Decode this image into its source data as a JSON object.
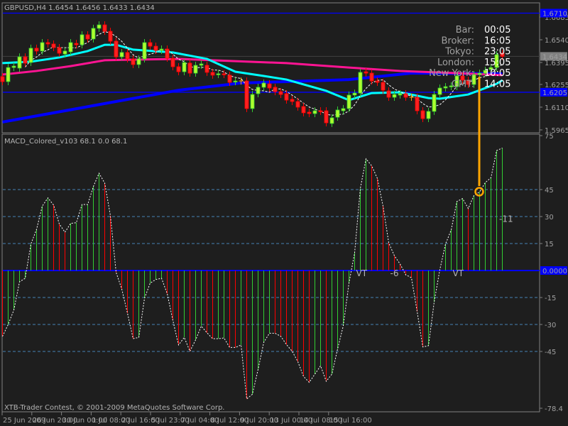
{
  "price_panel": {
    "title": "GBPUSD,H4  1.6454 1.6456 1.6433 1.6434",
    "axis_labels": [
      "1.6685",
      "1.6540",
      "1.6395",
      "1.6255",
      "1.6110",
      "1.5965"
    ],
    "axis_values": [
      1.6685,
      1.654,
      1.6395,
      1.6255,
      1.611,
      1.5965
    ],
    "hlines": [
      {
        "label": "1.6710",
        "value": 1.671,
        "color": "#0000ff"
      },
      {
        "label": "1.6205",
        "value": 1.6205,
        "color": "#0000ff"
      }
    ],
    "current_price": {
      "label": "1.6434",
      "value": 1.6434
    },
    "colors": {
      "bull": "#adff2f",
      "bear": "#ff2020",
      "bull_edge": "#32cd32",
      "bear_edge": "#ff0000",
      "doji": "#ffa500",
      "ma_fast": "#ffffff",
      "ma_mid": "#00ffff",
      "ma_slow": "#ff1493",
      "ma_long": "#0000ff"
    },
    "candles_oc": [
      [
        1.6305,
        1.6273
      ],
      [
        1.6273,
        1.6363
      ],
      [
        1.6363,
        1.6372
      ],
      [
        1.6359,
        1.6431
      ],
      [
        1.6431,
        1.6391
      ],
      [
        1.6395,
        1.6486
      ],
      [
        1.6486,
        1.6468
      ],
      [
        1.6468,
        1.6522
      ],
      [
        1.6522,
        1.6513
      ],
      [
        1.6513,
        1.649
      ],
      [
        1.649,
        1.6454
      ],
      [
        1.6449,
        1.6468
      ],
      [
        1.6463,
        1.6522
      ],
      [
        1.6517,
        1.6508
      ],
      [
        1.6508,
        1.6572
      ],
      [
        1.6572,
        1.6545
      ],
      [
        1.6545,
        1.6613
      ],
      [
        1.6613,
        1.6635
      ],
      [
        1.6635,
        1.6594
      ],
      [
        1.6594,
        1.6531
      ],
      [
        1.6531,
        1.6431
      ],
      [
        1.6431,
        1.6459
      ],
      [
        1.6459,
        1.6418
      ],
      [
        1.6418,
        1.6382
      ],
      [
        1.6382,
        1.6418
      ],
      [
        1.6418,
        1.6522
      ],
      [
        1.6522,
        1.6499
      ],
      [
        1.6499,
        1.6472
      ],
      [
        1.6472,
        1.6481
      ],
      [
        1.6481,
        1.6422
      ],
      [
        1.6422,
        1.6368
      ],
      [
        1.6368,
        1.6336
      ],
      [
        1.6336,
        1.6395
      ],
      [
        1.6391,
        1.6327
      ],
      [
        1.6327,
        1.6377
      ],
      [
        1.6377,
        1.6386
      ],
      [
        1.6377,
        1.6332
      ],
      [
        1.6332,
        1.6314
      ],
      [
        1.6318,
        1.6323
      ],
      [
        1.6323,
        1.6318
      ],
      [
        1.6314,
        1.6268
      ],
      [
        1.6273,
        1.6277
      ],
      [
        1.6277,
        1.6277
      ],
      [
        1.6277,
        1.6101
      ],
      [
        1.6101,
        1.6191
      ],
      [
        1.6196,
        1.6237
      ],
      [
        1.6237,
        1.6264
      ],
      [
        1.6259,
        1.6232
      ],
      [
        1.6237,
        1.6209
      ],
      [
        1.6209,
        1.6191
      ],
      [
        1.6196,
        1.6155
      ],
      [
        1.616,
        1.6146
      ],
      [
        1.6146,
        1.611
      ],
      [
        1.6114,
        1.6074
      ],
      [
        1.6078,
        1.6069
      ],
      [
        1.6069,
        1.6087
      ],
      [
        1.6087,
        1.6083
      ],
      [
        1.6087,
        1.601
      ],
      [
        1.6006,
        1.6042
      ],
      [
        1.6046,
        1.6092
      ],
      [
        1.6087,
        1.6101
      ],
      [
        1.6101,
        1.6187
      ],
      [
        1.6187,
        1.62
      ],
      [
        1.62,
        1.6332
      ],
      [
        1.6336,
        1.6327
      ],
      [
        1.6327,
        1.6277
      ],
      [
        1.6277,
        1.6268
      ],
      [
        1.6268,
        1.6218
      ],
      [
        1.6214,
        1.6173
      ],
      [
        1.6173,
        1.6191
      ],
      [
        1.6187,
        1.6196
      ],
      [
        1.6196,
        1.6173
      ],
      [
        1.6173,
        1.6173
      ],
      [
        1.6173,
        1.6087
      ],
      [
        1.6087,
        1.6037
      ],
      [
        1.6037,
        1.6083
      ],
      [
        1.6083,
        1.6191
      ],
      [
        1.6191,
        1.6232
      ],
      [
        1.6232,
        1.6241
      ],
      [
        1.6241,
        1.6246
      ],
      [
        1.6241,
        1.6309
      ],
      [
        1.6309,
        1.6282
      ],
      [
        1.6282,
        1.6255
      ],
      [
        1.6255,
        1.6318
      ],
      [
        1.6318,
        1.6327
      ],
      [
        1.6327,
        1.6345
      ],
      [
        1.635,
        1.6363
      ],
      [
        1.6363,
        1.6445
      ],
      [
        1.6454,
        1.6434
      ]
    ],
    "ma_mid": [
      [
        0,
        1.6391
      ],
      [
        5,
        1.64
      ],
      [
        10,
        1.6427
      ],
      [
        15,
        1.6468
      ],
      [
        18,
        1.6508
      ],
      [
        20,
        1.6508
      ],
      [
        23,
        1.6477
      ],
      [
        30,
        1.6459
      ],
      [
        36,
        1.6418
      ],
      [
        41,
        1.6336
      ],
      [
        46,
        1.6309
      ],
      [
        50,
        1.6286
      ],
      [
        57,
        1.6214
      ],
      [
        61,
        1.6155
      ],
      [
        65,
        1.62
      ],
      [
        70,
        1.6205
      ],
      [
        75,
        1.6168
      ],
      [
        77,
        1.6164
      ],
      [
        82,
        1.6191
      ],
      [
        87,
        1.6259
      ],
      [
        88,
        1.6282
      ]
    ],
    "ma_slow": [
      [
        0,
        1.6318
      ],
      [
        6,
        1.6341
      ],
      [
        12,
        1.6372
      ],
      [
        18,
        1.6409
      ],
      [
        23,
        1.6413
      ],
      [
        31,
        1.6418
      ],
      [
        37,
        1.6409
      ],
      [
        50,
        1.6391
      ],
      [
        61,
        1.6363
      ],
      [
        70,
        1.6341
      ],
      [
        80,
        1.6327
      ],
      [
        88,
        1.6314
      ]
    ],
    "ma_long": [
      [
        0,
        1.6015
      ],
      [
        31,
        1.6218
      ],
      [
        42,
        1.6264
      ],
      [
        50,
        1.6273
      ],
      [
        61,
        1.6286
      ],
      [
        72,
        1.6327
      ],
      [
        88,
        1.6323
      ]
    ]
  },
  "clock": {
    "rows": [
      {
        "label": "Bar:",
        "value": "00:05"
      },
      {
        "label": "Broker:",
        "value": "16:05"
      },
      {
        "label": "Tokyo:",
        "value": "23:05"
      },
      {
        "label": "London:",
        "value": "15:05"
      },
      {
        "label": "New York:",
        "value": "10:05"
      },
      {
        "label": "GMT:",
        "value": "14:05"
      }
    ]
  },
  "macd_panel": {
    "title": "MACD_Colored_v103 68.1 0.0 68.1",
    "axis_labels": [
      "75",
      "45",
      "30",
      "15",
      "-15",
      "-30",
      "-45",
      "-78.4"
    ],
    "axis_values": [
      75,
      45,
      30,
      15,
      -15,
      -30,
      -45,
      -78.4
    ],
    "zero_label": "0.0000",
    "levels": [
      45,
      30,
      15,
      -15,
      -30,
      -45
    ],
    "annotations": [
      {
        "text": "VT",
        "bar": 64
      },
      {
        "text": "-6",
        "bar": 70
      },
      {
        "text": "VT",
        "bar": 81
      },
      {
        "text": "-11",
        "bar": 89
      }
    ],
    "colors": {
      "up": "#32cd32",
      "down": "#ff0000",
      "line": "#ffffff",
      "zero": "#0000ff",
      "level": "#4682b4",
      "marker": "#ffa500"
    },
    "histogram": [
      -36.6,
      -30,
      -22,
      -6.3,
      -4.3,
      14.7,
      22.9,
      35.8,
      40.4,
      36.4,
      25.9,
      21.3,
      26.2,
      26.6,
      36.7,
      36.7,
      46.7,
      54.1,
      48.6,
      30.5,
      -1,
      -10.3,
      -23.7,
      -37.9,
      -37.2,
      -15.5,
      -7,
      -5,
      -4.3,
      -12.9,
      -27.8,
      -41.4,
      -37.2,
      -44.9,
      -38.6,
      -30.9,
      -34.6,
      -37.9,
      -37.9,
      -37.5,
      -42.8,
      -42.8,
      -41.4,
      -71.4,
      -68.8,
      -55,
      -39.9,
      -34.9,
      -34.9,
      -36.6,
      -41.2,
      -44.9,
      -50.7,
      -58.9,
      -62.2,
      -57.6,
      -53,
      -61.6,
      -57.6,
      -43.6,
      -30.7,
      -7,
      9.9,
      45.7,
      62.1,
      58.2,
      51.2,
      35.8,
      15.4,
      8.2,
      3.6,
      -2.4,
      -4,
      -22.8,
      -42.5,
      -41.8,
      -17.5,
      0.5,
      14.7,
      22.6,
      38.4,
      40,
      34.5,
      41.7,
      43.7,
      48.9,
      51.6,
      66.7,
      68.1
    ],
    "histogram_colors": [
      "down",
      "up",
      "up",
      "up",
      "up",
      "up",
      "up",
      "up",
      "up",
      "down",
      "down",
      "down",
      "up",
      "up",
      "up",
      "up",
      "up",
      "up",
      "down",
      "down",
      "down",
      "down",
      "down",
      "down",
      "up",
      "up",
      "up",
      "up",
      "up",
      "down",
      "down",
      "down",
      "up",
      "down",
      "up",
      "up",
      "down",
      "down",
      "up",
      "up",
      "down",
      "down",
      "up",
      "down",
      "up",
      "up",
      "up",
      "up",
      "down",
      "down",
      "down",
      "down",
      "down",
      "down",
      "down",
      "up",
      "up",
      "down",
      "up",
      "up",
      "up",
      "up",
      "up",
      "up",
      "up",
      "down",
      "down",
      "down",
      "down",
      "down",
      "down",
      "down",
      "down",
      "down",
      "down",
      "up",
      "up",
      "up",
      "up",
      "up",
      "up",
      "up",
      "down",
      "up",
      "up",
      "up",
      "up",
      "up",
      "up"
    ]
  },
  "time_axis": [
    "25 Jun 2009",
    "26 Jun 20:00",
    "30 Jun 00:00",
    "1 Jul 08:00",
    "2 Jul 16:00",
    "5 Jul 23:00",
    "7 Jul 04:00",
    "8 Jul 12:00",
    "9 Jul 20:00",
    "13 Jul 00:00",
    "14 Jul 08:00",
    "15 Jul 16:00"
  ],
  "footer": "XTB-Trader Contest, © 2001-2009 MetaQuotes Software Corp."
}
